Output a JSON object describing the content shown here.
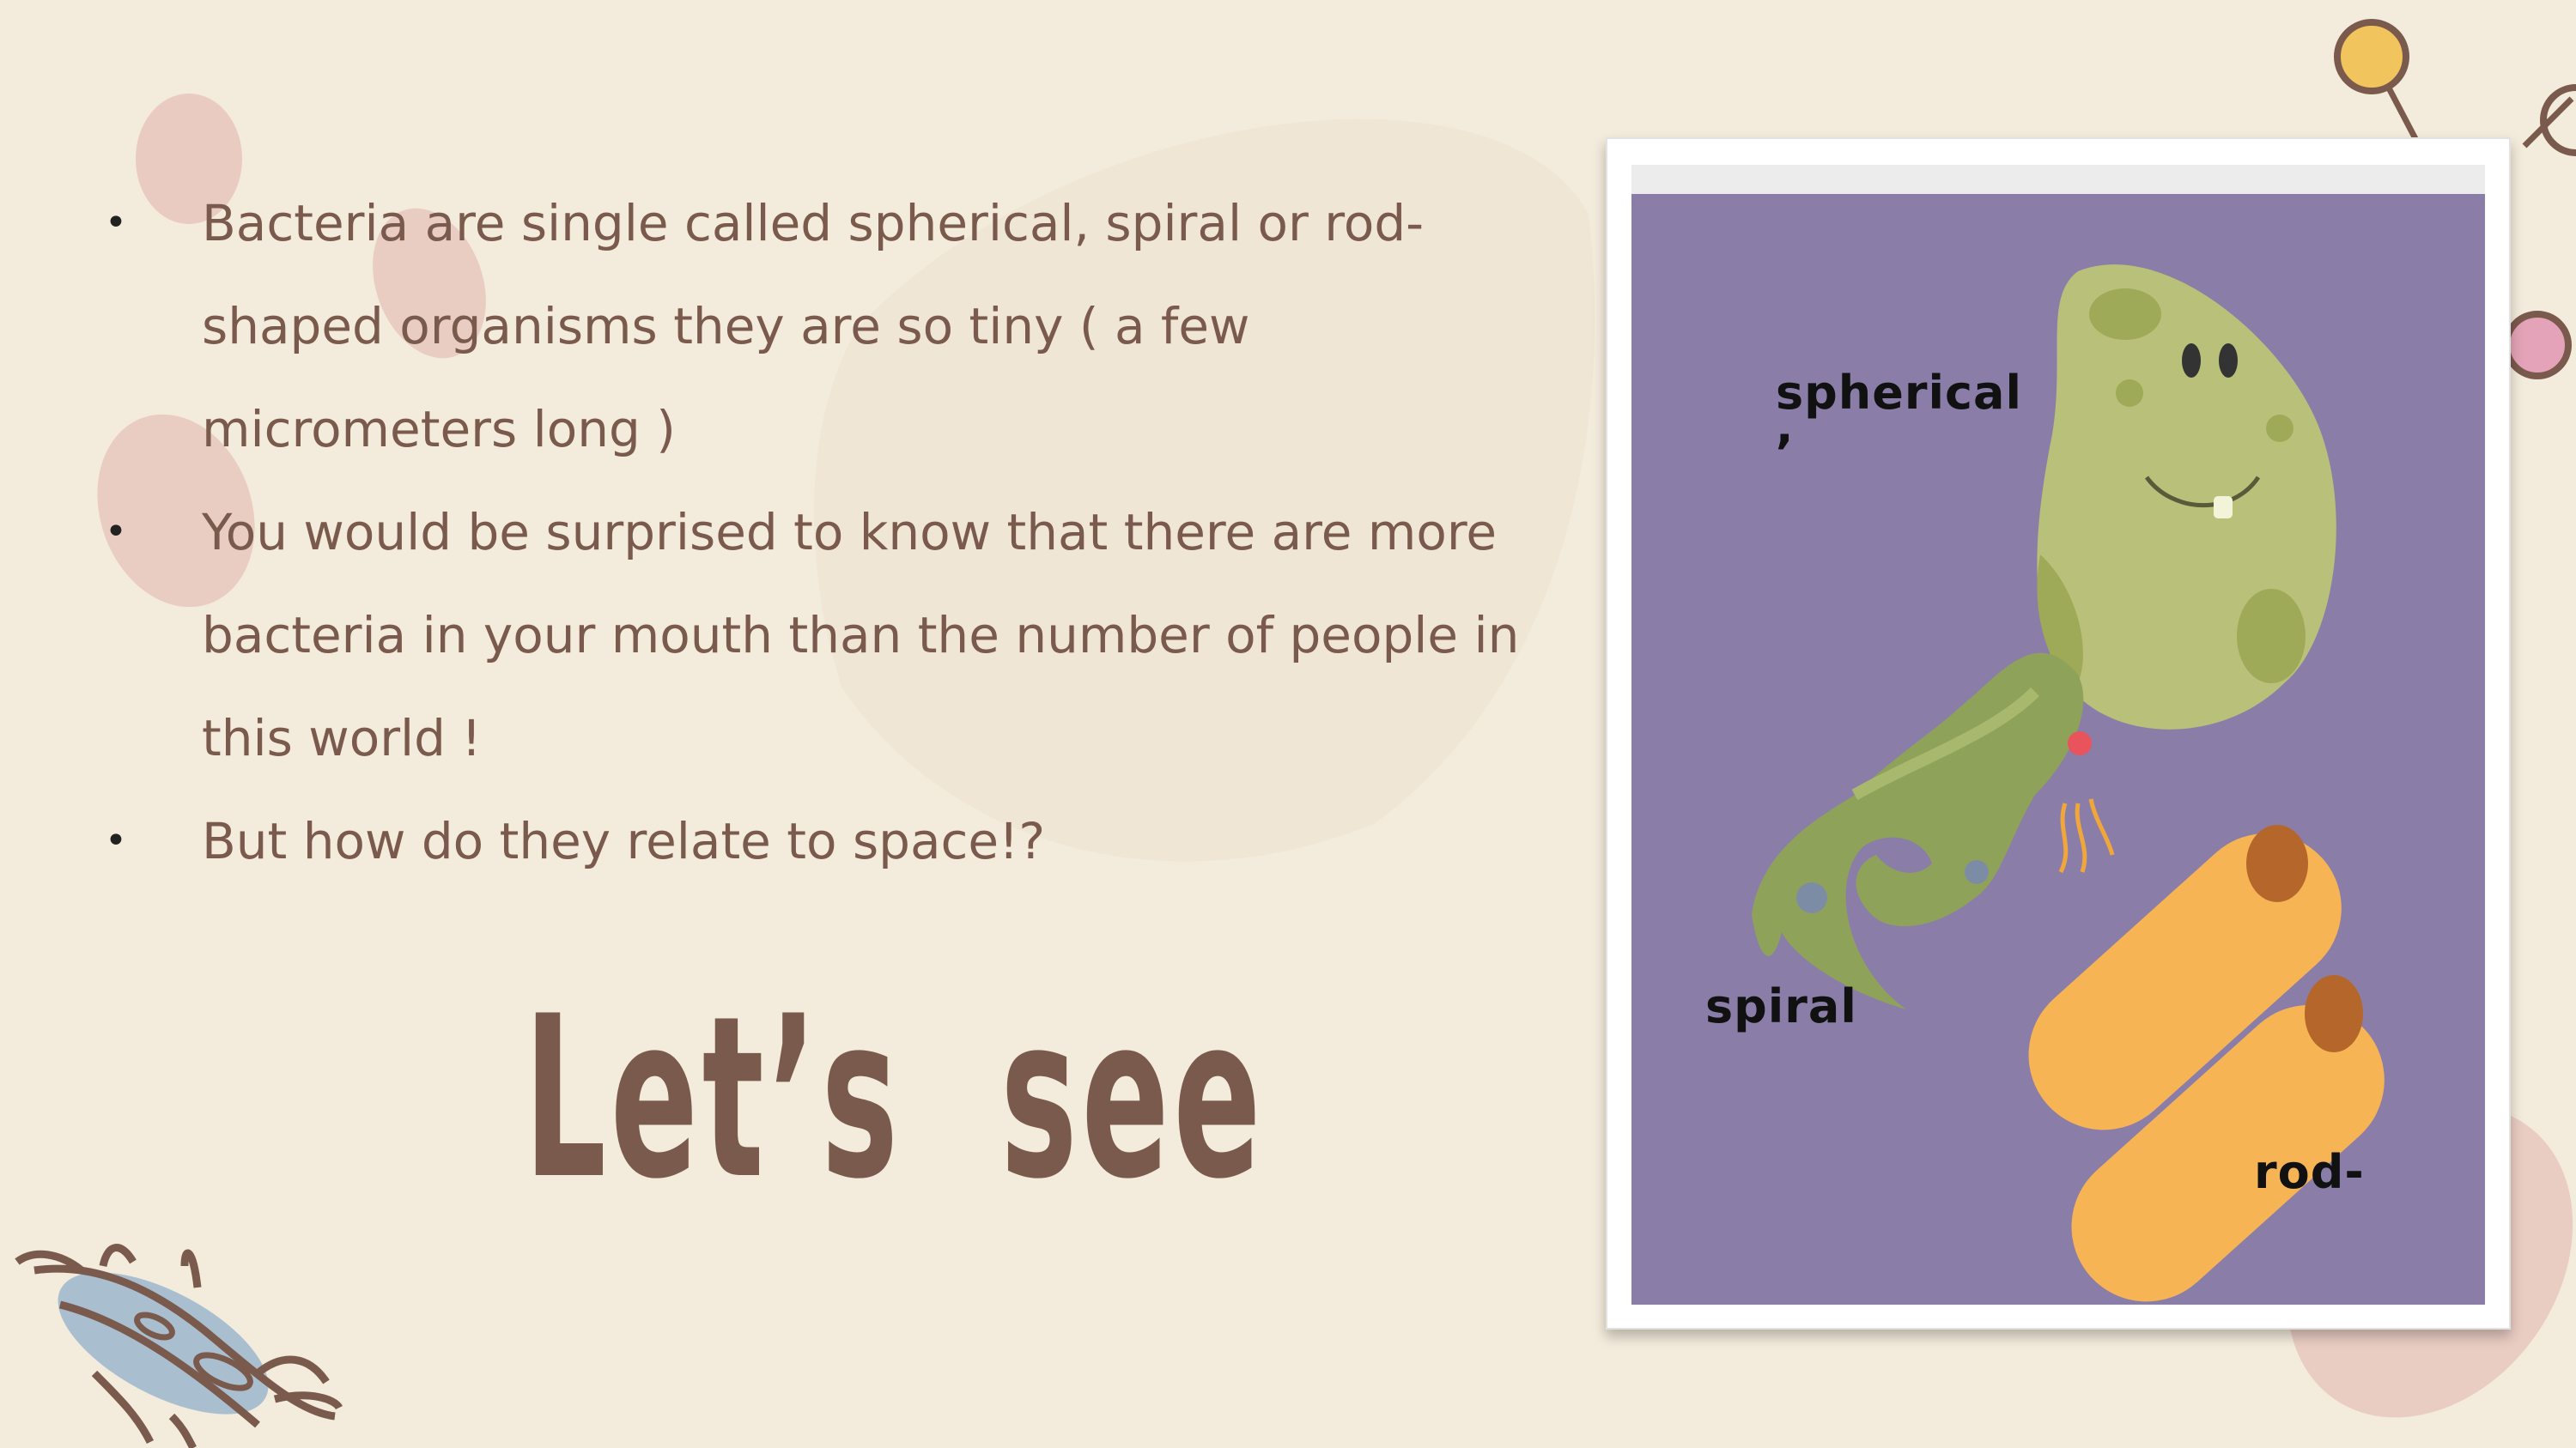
{
  "bullets": [
    "Bacteria are single called spherical, spiral or rod-shaped organisms they are so tiny ( a few micrometers long )",
    " You would be surprised to know that there are more bacteria in your mouth than the number of people in this world !",
    "But how do they relate to space!?"
  ],
  "bullet_symbol": "•",
  "closing_text": "Let’s  see",
  "image_labels": {
    "spherical": "spherical",
    "comma": ",",
    "spiral": "spiral",
    "rod": "rod-"
  },
  "colors": {
    "background": "#f3ebdb",
    "text": "#7a5a4c",
    "image_background": "#8a7ea8",
    "sphere_bacterium": "#b9c07a",
    "spiral_bacterium": "#8fa25a",
    "rod_bacterium": "#f6b455"
  },
  "icons": {
    "sphere": "spherical-bacterium-illustration",
    "spiral": "spiral-bacterium-illustration",
    "rod": "rod-bacterium-illustration",
    "molecule": "molecule-doodle-icon",
    "bacterium_doodle": "bacterium-doodle-icon"
  }
}
